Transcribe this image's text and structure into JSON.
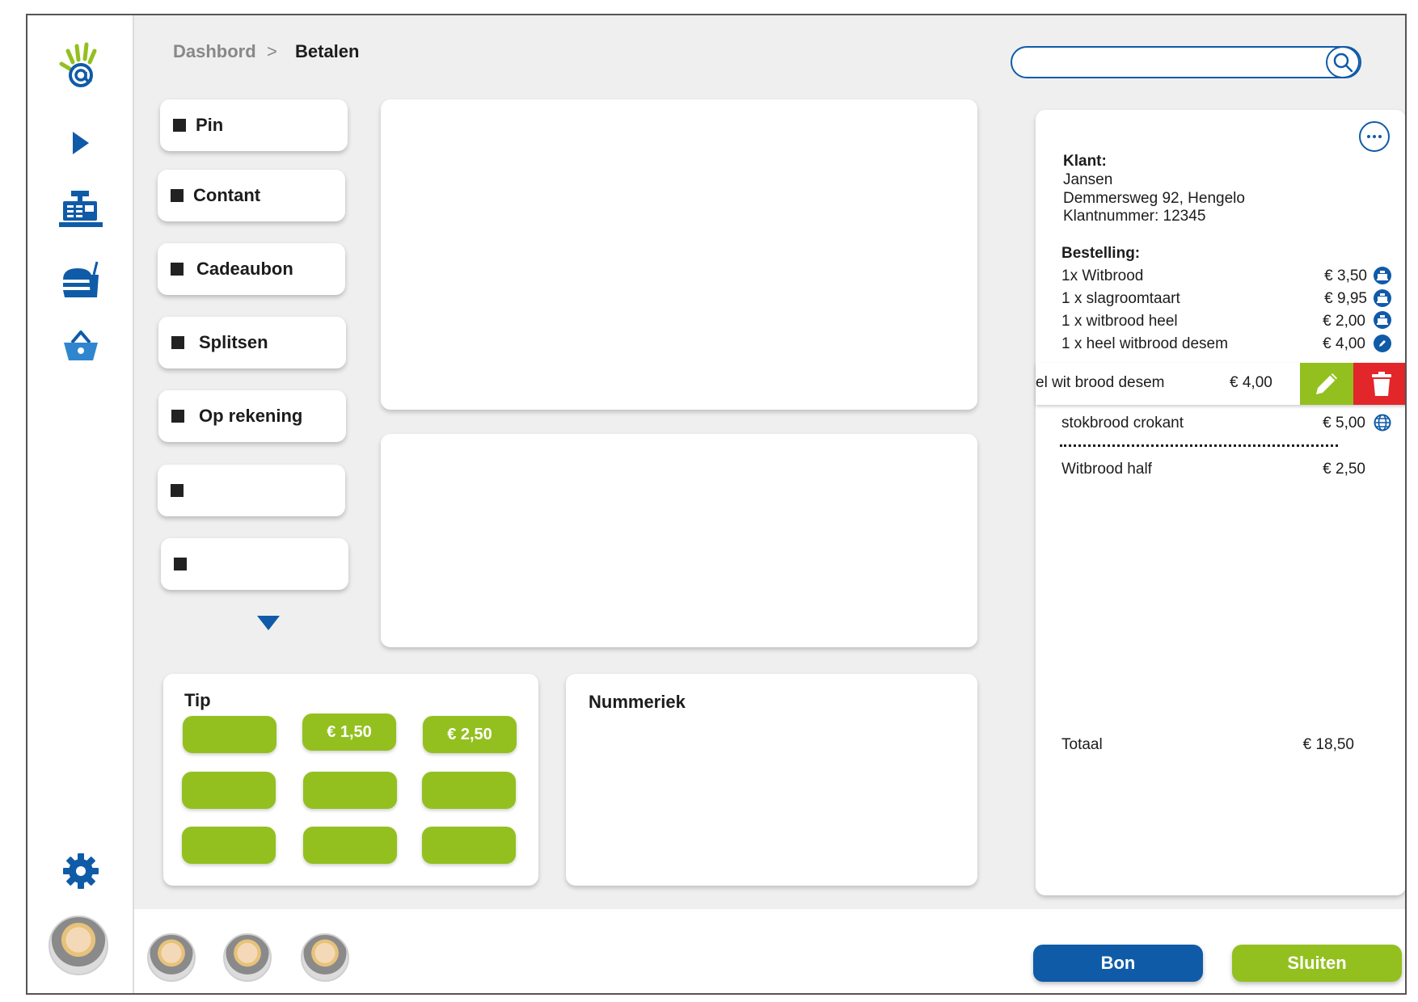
{
  "breadcrumb": {
    "parent": "Dashbord",
    "separator": ">",
    "current": "Betalen"
  },
  "search": {
    "placeholder": ""
  },
  "payment_methods": [
    "Pin",
    "Contant",
    "Cadeaubon",
    "Splitsen",
    "Op rekening",
    "",
    ""
  ],
  "tip": {
    "title": "Tip",
    "buttons": [
      "",
      "€ 1,50",
      "€ 2,50",
      "",
      "",
      "",
      "",
      "",
      ""
    ]
  },
  "numeric": {
    "title": "Nummeriek"
  },
  "order": {
    "klant_label": "Klant:",
    "klant_name": "Jansen",
    "klant_address": "Demmersweg 92, Hengelo",
    "klant_number": "Klantnummer: 12345",
    "bestelling_label": "Bestelling:",
    "items": [
      {
        "name": "1x Witbrood",
        "price": "€ 3,50",
        "icon": "register-icon"
      },
      {
        "name": "1 x slagroomtaart",
        "price": "€ 9,95",
        "icon": "register-icon"
      },
      {
        "name": "1 x witbrood heel",
        "price": "€ 2,00",
        "icon": "register-icon"
      },
      {
        "name": "1 x heel witbrood desem",
        "price": "€ 4,00",
        "icon": "pencil-icon"
      }
    ],
    "swipe_item": {
      "name": "el wit brood desem",
      "price": "€ 4,00"
    },
    "online_item": {
      "name": "stokbrood crokant",
      "price": "€ 5,00",
      "icon": "globe-icon"
    },
    "extra_item": {
      "name": "Witbrood half",
      "price": "€ 2,50"
    },
    "total_label": "Totaal",
    "total_value": "€ 18,50"
  },
  "actions": {
    "bon": "Bon",
    "sluiten": "Sluiten"
  },
  "colors": {
    "brand_blue": "#0f5ba8",
    "brand_green": "#93c01f",
    "delete_red": "#e3262a"
  }
}
